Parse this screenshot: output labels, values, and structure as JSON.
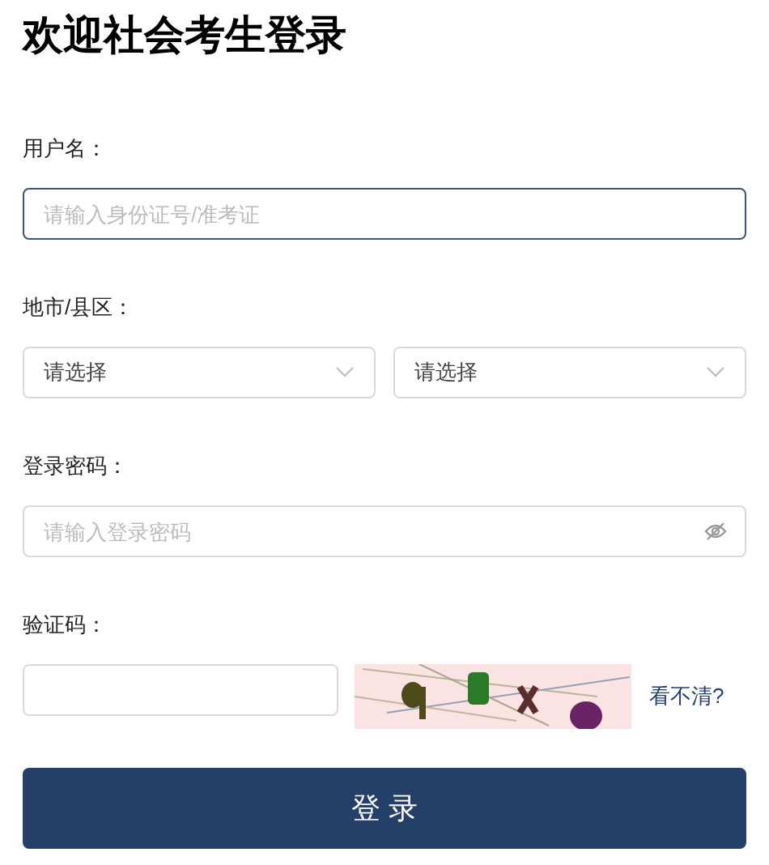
{
  "title": "欢迎社会考生登录",
  "username": {
    "label": "用户名：",
    "placeholder": "请输入身份证号/准考证",
    "focused": true
  },
  "region": {
    "label": "地市/县区：",
    "selects": [
      {
        "value": "请选择"
      },
      {
        "value": "请选择"
      }
    ]
  },
  "password": {
    "label": "登录密码：",
    "placeholder": "请输入登录密码"
  },
  "captcha": {
    "label": "验证码：",
    "refresh_link": "看不清?"
  },
  "submit": "登 录"
}
